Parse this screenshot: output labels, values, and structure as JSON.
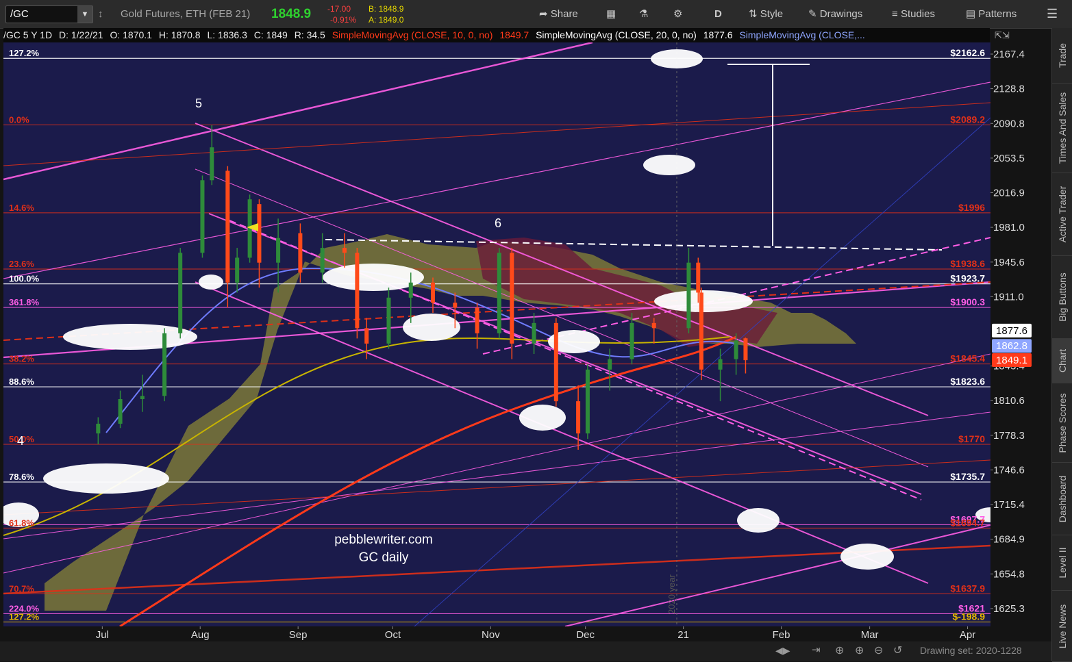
{
  "toolbar": {
    "symbol": "/GC",
    "instrument": "Gold Futures, ETH (FEB 21)",
    "last": "1848.9",
    "change": "-17.00",
    "change_pct": "-0.91%",
    "bid": "B: 1848.9",
    "ask": "A: 1849.0",
    "share": "Share",
    "aggregation": "D",
    "style": "Style",
    "drawings": "Drawings",
    "studies": "Studies",
    "patterns": "Patterns"
  },
  "infobar": {
    "symbol": "/GC 5 Y 1D",
    "date": "D: 1/22/21",
    "open": "O: 1870.1",
    "high": "H: 1870.8",
    "low": "L: 1836.3",
    "close": "C: 1849",
    "range": "R: 34.5",
    "sma10_label": "SimpleMovingAvg (CLOSE, 10, 0, no)",
    "sma10_value": "1849.7",
    "sma20_label": "SimpleMovingAvg (CLOSE, 20, 0, no)",
    "sma20_value": "1877.6",
    "sma50_label": "SimpleMovingAvg (CLOSE,..."
  },
  "sidebar": [
    "Trade",
    "Times And Sales",
    "Active Trader",
    "Big Buttons",
    "Chart",
    "Phase Scores",
    "Dashboard",
    "Level II",
    "Live News"
  ],
  "bottombar": {
    "drawing_set": "Drawing set: 2020-1228"
  },
  "colors": {
    "background": "#1b1b4b",
    "candle_up": "#2e8b3a",
    "candle_down": "#ff4a1a",
    "magenta": "#ff5ee6",
    "fib_red": "#e03018",
    "yellow": "#e6d800",
    "white": "#ffffff"
  },
  "chart_data": {
    "type": "candlestick",
    "title": "pebblewriter.com GC daily",
    "watermark_lines": [
      "pebblewriter.com",
      "GC daily"
    ],
    "x_ticks": [
      "Jul",
      "Aug",
      "Sep",
      "Oct",
      "Nov",
      "Dec",
      "21",
      "Feb",
      "Mar",
      "Apr"
    ],
    "y_ticks": [
      2167.4,
      2128.8,
      2090.8,
      2053.5,
      2016.9,
      1981,
      1945.6,
      1911,
      1843.4,
      1810.6,
      1778.3,
      1746.6,
      1715.4,
      1684.9,
      1654.8,
      1625.3
    ],
    "y_scale": "log",
    "ylim": [
      1614,
      2185
    ],
    "current_price_markers": [
      {
        "value": "1877.6",
        "color": "#ffffff"
      },
      {
        "value": "1862.8",
        "color": "#8fa6ff"
      },
      {
        "value": "1849.1",
        "color": "#ff3a1a"
      }
    ],
    "price_levels": [
      {
        "label": "$2162.6",
        "value": 2162.6,
        "color": "#ffffff"
      },
      {
        "label": "$2089.2",
        "value": 2089.2,
        "color": "#e03018"
      },
      {
        "label": "$1996",
        "value": 1996,
        "color": "#e03018"
      },
      {
        "label": "$1938.6",
        "value": 1938.6,
        "color": "#e03018"
      },
      {
        "label": "$1923.7",
        "value": 1923.7,
        "color": "#ffffff"
      },
      {
        "label": "$1900.3",
        "value": 1900.3,
        "color": "#ff5ee6"
      },
      {
        "label": "$1845.4",
        "value": 1845.4,
        "color": "#e03018"
      },
      {
        "label": "$1823.6",
        "value": 1823.6,
        "color": "#ffffff"
      },
      {
        "label": "$1770",
        "value": 1770,
        "color": "#e03018"
      },
      {
        "label": "$1735.7",
        "value": 1735.7,
        "color": "#ffffff"
      },
      {
        "label": "$1697.7",
        "value": 1697.7,
        "color": "#ff5ee6"
      },
      {
        "label": "$1694.7",
        "value": 1694.7,
        "color": "#e03018"
      },
      {
        "label": "$1637.9",
        "value": 1637.9,
        "color": "#e03018"
      },
      {
        "label": "$1621",
        "value": 1621,
        "color": "#ff5ee6"
      },
      {
        "label": "$-198.9",
        "value": 1614,
        "color": "#e6b800"
      }
    ],
    "fib_labels": [
      {
        "label": "127.2%",
        "value": 2162.6,
        "color": "#ffffff"
      },
      {
        "label": "0.0%",
        "value": 2089.2,
        "color": "#e03018"
      },
      {
        "label": "14.6%",
        "value": 1996,
        "color": "#e03018"
      },
      {
        "label": "23.6%",
        "value": 1938.6,
        "color": "#e03018"
      },
      {
        "label": "100.0%",
        "value": 1923.7,
        "color": "#ffffff"
      },
      {
        "label": "361.8%",
        "value": 1900.3,
        "color": "#ff5ee6"
      },
      {
        "label": "38.2%",
        "value": 1845.4,
        "color": "#e03018"
      },
      {
        "label": "88.6%",
        "value": 1823.6,
        "color": "#ffffff"
      },
      {
        "label": "50.0%",
        "value": 1770,
        "color": "#e03018"
      },
      {
        "label": "78.6%",
        "value": 1735.7,
        "color": "#ffffff"
      },
      {
        "label": "61.8%",
        "value": 1694.7,
        "color": "#e03018"
      },
      {
        "label": "70.7%",
        "value": 1637.9,
        "color": "#e03018"
      },
      {
        "label": "224.0%",
        "value": 1621,
        "color": "#ff5ee6"
      },
      {
        "label": "127.2%",
        "value": 1614,
        "color": "#e6b800"
      }
    ],
    "wave_labels": [
      "5",
      "6",
      "4"
    ],
    "year_marker": "2020 year",
    "candles": [
      {
        "date": "2020-07-01",
        "o": 1780,
        "h": 1795,
        "l": 1770,
        "c": 1789
      },
      {
        "date": "2020-07-08",
        "o": 1789,
        "h": 1820,
        "l": 1785,
        "c": 1812
      },
      {
        "date": "2020-07-15",
        "o": 1812,
        "h": 1835,
        "l": 1800,
        "c": 1815
      },
      {
        "date": "2020-07-22",
        "o": 1815,
        "h": 1880,
        "l": 1810,
        "c": 1875
      },
      {
        "date": "2020-07-27",
        "o": 1875,
        "h": 1960,
        "l": 1870,
        "c": 1955
      },
      {
        "date": "2020-08-03",
        "o": 1955,
        "h": 2035,
        "l": 1950,
        "c": 2030
      },
      {
        "date": "2020-08-06",
        "o": 2030,
        "h": 2089,
        "l": 2025,
        "c": 2065
      },
      {
        "date": "2020-08-11",
        "o": 2040,
        "h": 2045,
        "l": 1900,
        "c": 1925
      },
      {
        "date": "2020-08-14",
        "o": 1925,
        "h": 1960,
        "l": 1915,
        "c": 1950
      },
      {
        "date": "2020-08-18",
        "o": 1950,
        "h": 2015,
        "l": 1945,
        "c": 2010
      },
      {
        "date": "2020-08-21",
        "o": 2005,
        "h": 2010,
        "l": 1920,
        "c": 1945
      },
      {
        "date": "2020-08-27",
        "o": 1945,
        "h": 1990,
        "l": 1915,
        "c": 1970
      },
      {
        "date": "2020-09-03",
        "o": 1975,
        "h": 1985,
        "l": 1925,
        "c": 1935
      },
      {
        "date": "2020-09-10",
        "o": 1935,
        "h": 1975,
        "l": 1925,
        "c": 1960
      },
      {
        "date": "2020-09-17",
        "o": 1960,
        "h": 1975,
        "l": 1940,
        "c": 1955
      },
      {
        "date": "2020-09-21",
        "o": 1955,
        "h": 1960,
        "l": 1870,
        "c": 1880
      },
      {
        "date": "2020-09-24",
        "o": 1880,
        "h": 1890,
        "l": 1850,
        "c": 1865
      },
      {
        "date": "2020-10-01",
        "o": 1865,
        "h": 1920,
        "l": 1860,
        "c": 1910
      },
      {
        "date": "2020-10-08",
        "o": 1910,
        "h": 1935,
        "l": 1885,
        "c": 1925
      },
      {
        "date": "2020-10-15",
        "o": 1925,
        "h": 1930,
        "l": 1895,
        "c": 1905
      },
      {
        "date": "2020-10-22",
        "o": 1905,
        "h": 1915,
        "l": 1880,
        "c": 1900
      },
      {
        "date": "2020-10-29",
        "o": 1900,
        "h": 1905,
        "l": 1860,
        "c": 1875
      },
      {
        "date": "2020-11-05",
        "o": 1875,
        "h": 1960,
        "l": 1870,
        "c": 1955
      },
      {
        "date": "2020-11-09",
        "o": 1955,
        "h": 1960,
        "l": 1850,
        "c": 1865
      },
      {
        "date": "2020-11-16",
        "o": 1865,
        "h": 1895,
        "l": 1855,
        "c": 1885
      },
      {
        "date": "2020-11-23",
        "o": 1885,
        "h": 1890,
        "l": 1805,
        "c": 1810
      },
      {
        "date": "2020-11-30",
        "o": 1810,
        "h": 1825,
        "l": 1765,
        "c": 1780
      },
      {
        "date": "2020-12-03",
        "o": 1780,
        "h": 1845,
        "l": 1775,
        "c": 1840
      },
      {
        "date": "2020-12-10",
        "o": 1840,
        "h": 1860,
        "l": 1820,
        "c": 1850
      },
      {
        "date": "2020-12-17",
        "o": 1850,
        "h": 1895,
        "l": 1845,
        "c": 1885
      },
      {
        "date": "2020-12-24",
        "o": 1885,
        "h": 1890,
        "l": 1865,
        "c": 1880
      },
      {
        "date": "2021-01-04",
        "o": 1880,
        "h": 1960,
        "l": 1875,
        "c": 1945
      },
      {
        "date": "2021-01-07",
        "o": 1945,
        "h": 1950,
        "l": 1905,
        "c": 1915
      },
      {
        "date": "2021-01-08",
        "o": 1915,
        "h": 1920,
        "l": 1830,
        "c": 1840
      },
      {
        "date": "2021-01-14",
        "o": 1840,
        "h": 1860,
        "l": 1810,
        "c": 1850
      },
      {
        "date": "2021-01-19",
        "o": 1850,
        "h": 1875,
        "l": 1835,
        "c": 1868
      },
      {
        "date": "2021-01-22",
        "o": 1870.1,
        "h": 1870.8,
        "l": 1836.3,
        "c": 1849
      }
    ]
  }
}
